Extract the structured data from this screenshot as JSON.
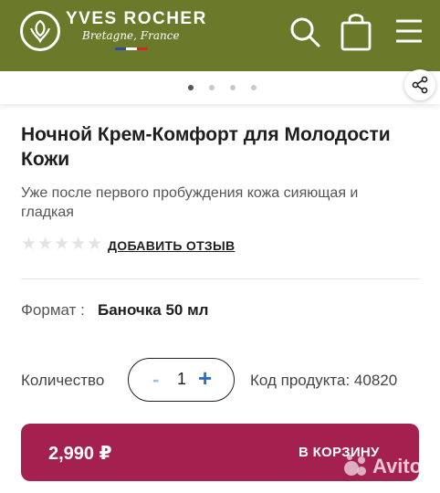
{
  "header": {
    "brand": "YVES ROCHER",
    "tagline": "Bretagne, France",
    "colors": {
      "background": "#6a7a2a",
      "flag_blue": "#2b4fa0",
      "flag_white": "#ffffff",
      "flag_red": "#d22a2a"
    },
    "icons": {
      "logo": "leaf-logo-icon",
      "search": "search-icon",
      "cart": "shopping-bag-icon",
      "menu": "hamburger-menu-icon"
    }
  },
  "carousel": {
    "dot_count": 4,
    "active_index": 0,
    "share_icon": "share-icon"
  },
  "product": {
    "title": "Ночной Крем-Комфорт для Молодости Кожи",
    "subtitle": "Уже после первого пробуждения кожа сияющая и гладкая",
    "rating": {
      "stars_total": 5,
      "stars_filled": 0,
      "add_review_label": "ДОБАВИТЬ ОТЗЫВ"
    },
    "format": {
      "label": "Формат :",
      "value": "Баночка 50 мл"
    },
    "quantity": {
      "label": "Количество",
      "minus": "-",
      "value": "1",
      "plus": "+"
    },
    "code": "Код продукта: 40820"
  },
  "cart_button": {
    "price": "2,990 ₽",
    "label": "В КОРЗИНУ",
    "color": "#a3204f"
  },
  "watermark": {
    "text": "Avito"
  }
}
